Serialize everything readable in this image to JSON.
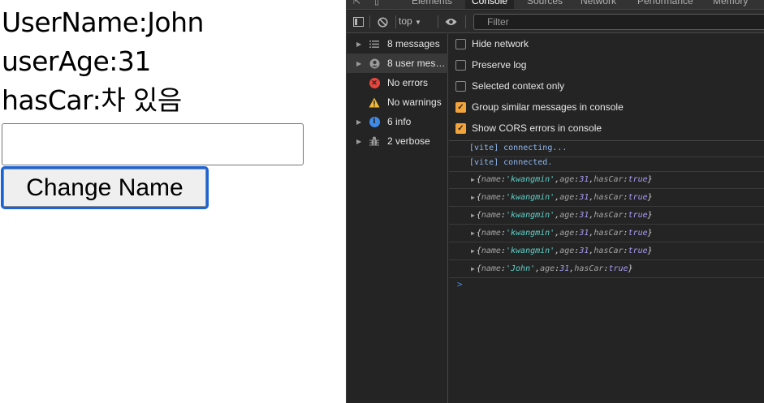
{
  "page": {
    "line1": "UserName:John",
    "line2": "userAge:31",
    "line3": "hasCar:차 있음",
    "input_value": "",
    "button_label": "Change Name"
  },
  "devtools": {
    "tabs": [
      "Elements",
      "Console",
      "Sources",
      "Network",
      "Performance",
      "Memory"
    ],
    "active_tab": "Console",
    "context": "top",
    "filter_placeholder": "Filter",
    "sidebar": [
      {
        "label": "8 messages",
        "icon": "list-icon"
      },
      {
        "label": "8 user mes…",
        "icon": "user-icon"
      },
      {
        "label": "No errors",
        "icon": "error-icon"
      },
      {
        "label": "No warnings",
        "icon": "warning-icon"
      },
      {
        "label": "6 info",
        "icon": "info-icon"
      },
      {
        "label": "2 verbose",
        "icon": "bug-icon"
      }
    ],
    "options": [
      {
        "label": "Hide network",
        "checked": false
      },
      {
        "label": "Preserve log",
        "checked": false
      },
      {
        "label": "Selected context only",
        "checked": false
      },
      {
        "label": "Group similar messages in console",
        "checked": true
      },
      {
        "label": "Show CORS errors in console",
        "checked": true
      }
    ],
    "logs": [
      {
        "text": "[vite] connecting..."
      },
      {
        "text": "[vite] connected."
      },
      {
        "name": "'kwangmin'",
        "age": "31",
        "hasCar": "true"
      },
      {
        "name": "'kwangmin'",
        "age": "31",
        "hasCar": "true"
      },
      {
        "name": "'kwangmin'",
        "age": "31",
        "hasCar": "true"
      },
      {
        "name": "'kwangmin'",
        "age": "31",
        "hasCar": "true"
      },
      {
        "name": "'kwangmin'",
        "age": "31",
        "hasCar": "true"
      },
      {
        "name": "'John'",
        "age": "31",
        "hasCar": "true"
      }
    ],
    "keys": {
      "name": "name",
      "age": "age",
      "hasCar": "hasCar"
    },
    "prompt": ">"
  },
  "colors": {
    "accent_checkbox": "#f2a33a",
    "button_focus": "#1a64d8",
    "devtools_bg": "#242424",
    "string_value": "#5fd4cb",
    "number_value": "#a89cf5"
  }
}
